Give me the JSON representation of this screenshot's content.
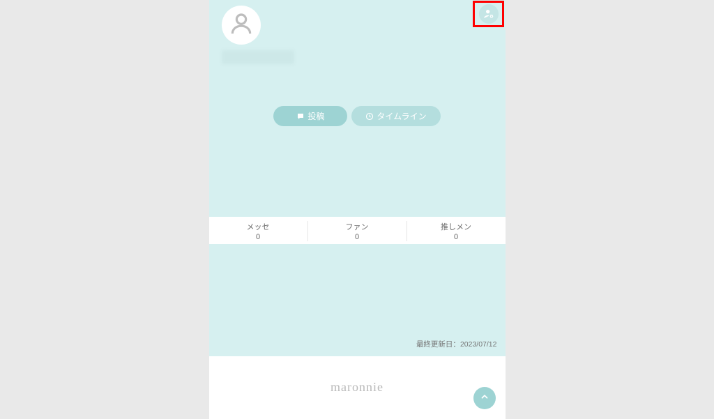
{
  "header": {
    "settings_icon": "user-gear"
  },
  "profile": {
    "username": "",
    "avatar_placeholder": true
  },
  "tabs": {
    "posts": {
      "label": "投稿",
      "icon": "speech"
    },
    "timeline": {
      "label": "タイムライン",
      "icon": "clock"
    }
  },
  "stats": [
    {
      "label": "メッセ",
      "count": "0"
    },
    {
      "label": "ファン",
      "count": "0"
    },
    {
      "label": "推しメン",
      "count": "0"
    }
  ],
  "meta": {
    "last_updated_label": "最終更新日：",
    "last_updated_value": "2023/07/12"
  },
  "footer": {
    "brand": "maronnie",
    "scroll_top_icon": "chevron-up"
  },
  "colors": {
    "page_bg": "#e9e9e9",
    "app_bg": "#d6f0f0",
    "accent": "#9dd3d3",
    "white": "#ffffff"
  }
}
